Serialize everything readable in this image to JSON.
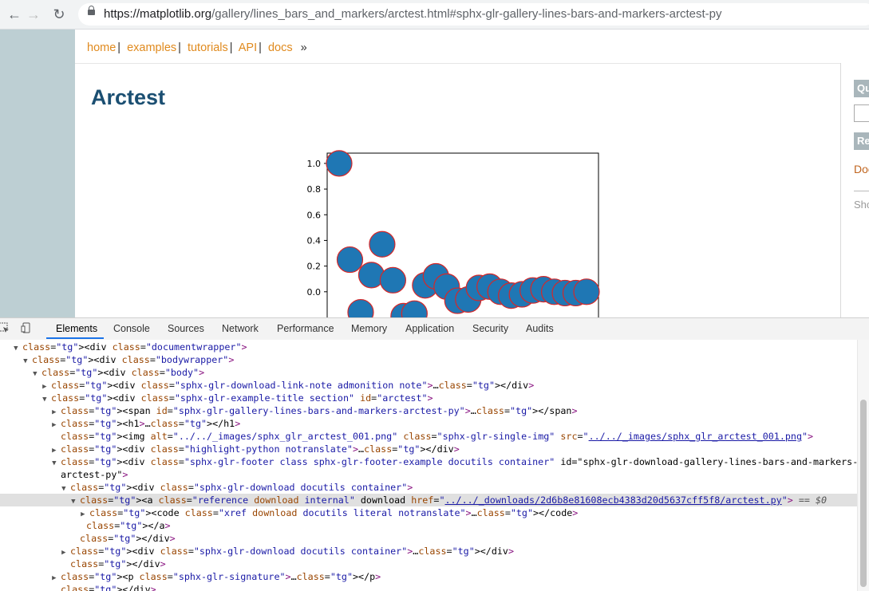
{
  "browser": {
    "url_host": "https://matplotlib.org",
    "url_path": "/gallery/lines_bars_and_markers/arctest.html#sphx-glr-gallery-lines-bars-and-markers-arctest-py"
  },
  "nav": {
    "items": [
      "home",
      "examples",
      "tutorials",
      "API",
      "docs"
    ],
    "separator": "|",
    "end": "»"
  },
  "page": {
    "title": "Arctest"
  },
  "sidebar": {
    "btn1": "Qu",
    "btn2": "Re",
    "link": "Doc",
    "text": "Sho"
  },
  "chart_data": {
    "type": "scatter",
    "yticks": [
      "1.0",
      "0.8",
      "0.6",
      "0.4",
      "0.2",
      "0.0"
    ],
    "ylim": [
      -0.2,
      1.08
    ],
    "points": [
      [
        0,
        1.0
      ],
      [
        1,
        0.25
      ],
      [
        2,
        -0.16
      ],
      [
        3,
        0.13
      ],
      [
        4,
        0.37
      ],
      [
        5,
        0.09
      ],
      [
        6,
        -0.19
      ],
      [
        7,
        -0.17
      ],
      [
        8,
        0.05
      ],
      [
        9,
        0.12
      ],
      [
        10,
        0.04
      ],
      [
        11,
        -0.07
      ],
      [
        12,
        -0.06
      ],
      [
        13,
        0.03
      ],
      [
        14,
        0.04
      ],
      [
        15,
        0.0
      ],
      [
        16,
        -0.03
      ],
      [
        17,
        -0.02
      ],
      [
        18,
        0.01
      ],
      [
        19,
        0.02
      ],
      [
        20,
        0.0
      ],
      [
        21,
        -0.01
      ],
      [
        22,
        -0.01
      ],
      [
        23,
        0.0
      ]
    ],
    "marker_color": "#1f77b4",
    "edge_color": "#d62728"
  },
  "devtools": {
    "tabs": [
      "Elements",
      "Console",
      "Sources",
      "Network",
      "Performance",
      "Memory",
      "Application",
      "Security",
      "Audits"
    ],
    "dom_lines": [
      "<div class=\"documentwrapper\">",
      "<div class=\"bodywrapper\">",
      "<div class=\"body\">",
      "<div class=\"sphx-glr-download-link-note admonition note\">…</div>",
      "<div class=\"sphx-glr-example-title section\" id=\"arctest\">",
      "<span id=\"sphx-glr-gallery-lines-bars-and-markers-arctest-py\">…</span>",
      "<h1>…</h1>",
      "<img alt=\"../../_images/sphx_glr_arctest_001.png\" class=\"sphx-glr-single-img\" src=\"../../_images/sphx_glr_arctest_001.png\">",
      "<div class=\"highlight-python notranslate\">…</div>",
      "<div class=\"sphx-glr-footer class sphx-glr-footer-example docutils container\" id=\"sphx-glr-download-gallery-lines-bars-and-markers-",
      "arctest-py\">",
      "<div class=\"sphx-glr-download docutils container\">",
      "<a class=\"reference download internal\" download href=\"../../_downloads/2d6b8e81608ecb4383d20d5637cff5f8/arctest.py\"> == $0",
      "<code class=\"xref download docutils literal notranslate\">…</code>",
      "</a>",
      "</div>",
      "<div class=\"sphx-glr-download docutils container\">…</div>",
      "</div>",
      "<p class=\"sphx-glr-signature\">…</p>",
      "</div>"
    ]
  }
}
